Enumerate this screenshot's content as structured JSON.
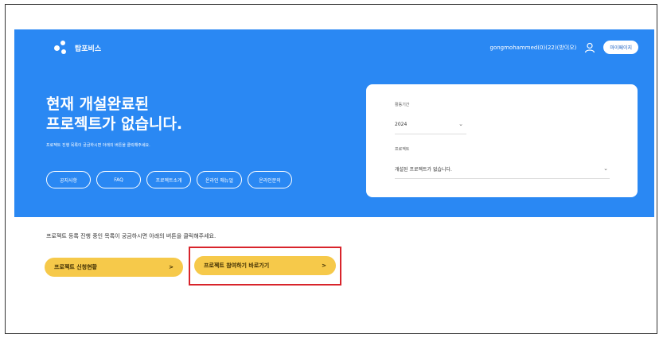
{
  "header": {
    "logo_text": "탑포비스",
    "user_name": "gongmohammed(0)(22)(방이오)",
    "mypage_label": "마이페이지"
  },
  "hero": {
    "title_line1": "현재 개설완료된",
    "title_line2": "프로젝트가 없습니다.",
    "subtitle": "프로젝트 진행 목록이 궁금하시면 아래의 버튼을 클릭해주세요.",
    "pills": [
      "공지사항",
      "FAQ",
      "프로젝트소개",
      "온라인 매뉴얼",
      "온라인문의"
    ]
  },
  "panel": {
    "period_label": "활동기간",
    "period_value": "2024",
    "project_label": "프로젝트",
    "project_value": "개설된 프로젝트가 없습니다."
  },
  "main": {
    "notice": "프로젝트 등록 진행 중인 목록이 궁금하시면 아래의 버튼을 클릭해주세요.",
    "btn_status": "프로젝트 신청현황",
    "btn_join": "프로젝트 참여하기 바로가기",
    "arrow": ">"
  },
  "colors": {
    "hero_bg": "#2a88f3",
    "cta_bg": "#f6c94a",
    "highlight": "#d8242b"
  },
  "icons": {
    "logo": "logo-mark-icon",
    "user": "user-icon",
    "chevron": "chevron-down-icon",
    "arrow": "chevron-right-icon"
  }
}
